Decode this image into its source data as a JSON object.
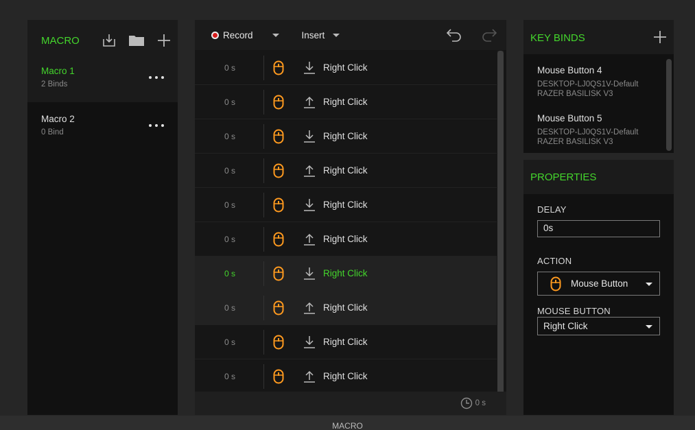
{
  "macro_panel": {
    "title": "MACRO",
    "items": [
      {
        "name": "Macro 1",
        "sub": "2 Binds"
      },
      {
        "name": "Macro 2",
        "sub": "0 Bind"
      }
    ]
  },
  "toolbar": {
    "record_label": "Record",
    "insert_label": "Insert"
  },
  "events": [
    {
      "time": "0 s",
      "direction": "down",
      "label": "Right Click"
    },
    {
      "time": "0 s",
      "direction": "up",
      "label": "Right Click"
    },
    {
      "time": "0 s",
      "direction": "down",
      "label": "Right Click"
    },
    {
      "time": "0 s",
      "direction": "up",
      "label": "Right Click"
    },
    {
      "time": "0 s",
      "direction": "down",
      "label": "Right Click"
    },
    {
      "time": "0 s",
      "direction": "up",
      "label": "Right Click"
    },
    {
      "time": "0 s",
      "direction": "down",
      "label": "Right Click"
    },
    {
      "time": "0 s",
      "direction": "up",
      "label": "Right Click"
    },
    {
      "time": "0 s",
      "direction": "down",
      "label": "Right Click"
    },
    {
      "time": "0 s",
      "direction": "up",
      "label": "Right Click"
    }
  ],
  "events_footer": {
    "total_time": "0 s"
  },
  "key_binds": {
    "title": "KEY BINDS",
    "items": [
      {
        "name": "Mouse Button 4",
        "device_line1": "DESKTOP-LJ0QS1V-Default",
        "device_line2": "RAZER BASILISK V3"
      },
      {
        "name": "Mouse Button 5",
        "device_line1": "DESKTOP-LJ0QS1V-Default",
        "device_line2": "RAZER BASILISK V3"
      }
    ]
  },
  "properties": {
    "title": "PROPERTIES",
    "delay_label": "DELAY",
    "delay_value": "0s",
    "action_label": "ACTION",
    "action_value": "Mouse Button",
    "mouse_button_label": "MOUSE BUTTON",
    "mouse_button_value": "Right Click"
  },
  "statusbar": {
    "label": "MACRO"
  },
  "colors": {
    "accent": "#44d62c",
    "mouse_icon": "#ff9a1f",
    "record": "#d81d1d"
  }
}
